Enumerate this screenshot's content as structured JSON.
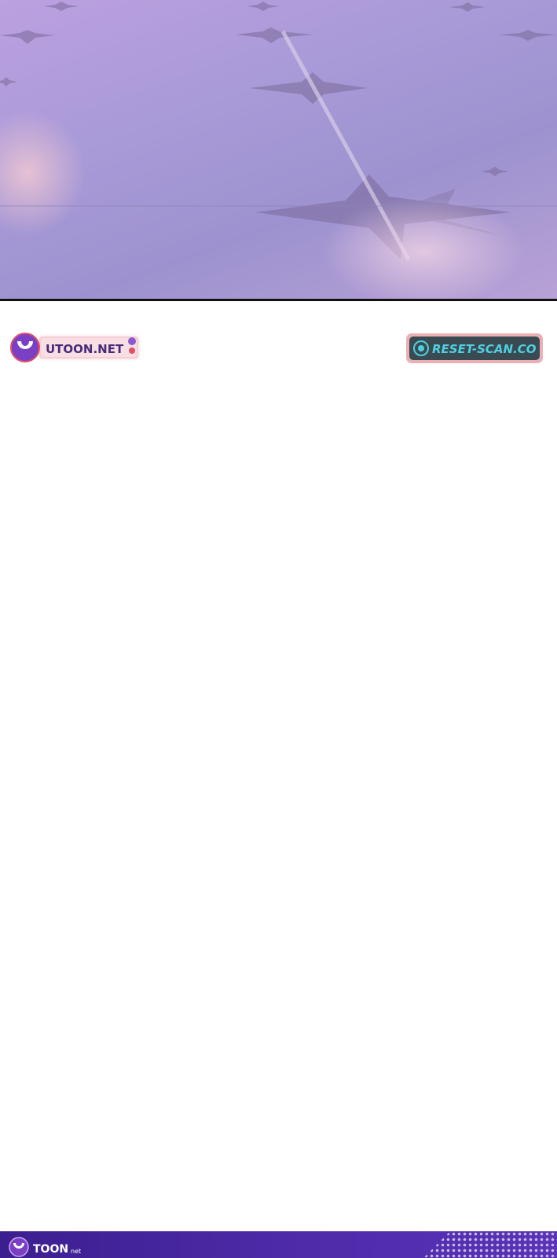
{
  "watermarks": {
    "utoon_text": "UTOON.NET",
    "reset_text": "RESET-SCAN.CO",
    "footer_text": "TOON",
    "footer_suffix": "net"
  },
  "colors": {
    "panel_purple": "#a99ad8",
    "star_color": "#7a6a9a",
    "utoon_purple": "#7b3fc4",
    "utoon_glow": "#e0506a",
    "reset_teal": "#4fd0e0",
    "footer_purple": "#4d2aa8"
  }
}
